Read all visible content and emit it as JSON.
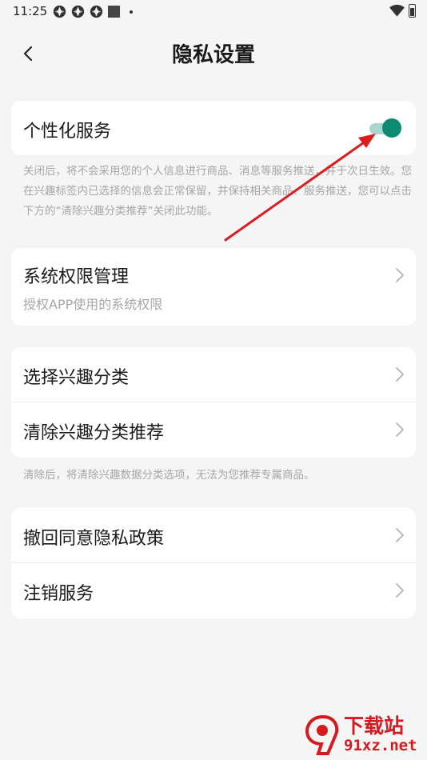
{
  "status_bar": {
    "time": "11:25",
    "icons_left": [
      "app-icon",
      "app-icon",
      "app-icon",
      "square-notification-icon",
      "dot-icon"
    ],
    "icons_right": [
      "wifi-icon",
      "battery-icon"
    ]
  },
  "header": {
    "back_icon": "chevron-left-icon",
    "title": "隐私设置"
  },
  "personalized": {
    "label": "个性化服务",
    "toggle_on": true,
    "toggle_color": "#0f8a72",
    "note": "关闭后，将不会采用您的个人信息进行商品、消息等服务推送，并于次日生效。您在兴趣标签内已选择的信息会正常保留，并保持相关商品、服务推送，您可以点击下方的“清除兴趣分类推荐”关闭此功能。"
  },
  "permissions": {
    "label": "系统权限管理",
    "subtitle": "授权APP使用的系统权限"
  },
  "interest": {
    "items": [
      {
        "label": "选择兴趣分类"
      },
      {
        "label": "清除兴趣分类推荐"
      }
    ],
    "note": "清除后，将清除兴趣数据分类选项，无法为您推荐专属商品。"
  },
  "policy": {
    "items": [
      {
        "label": "撤回同意隐私政策"
      },
      {
        "label": "注销服务"
      }
    ]
  },
  "annotation": {
    "arrow_color": "#d81e1e"
  },
  "watermark": {
    "text": "下载站",
    "url": "91xz.net",
    "color": "#d71920"
  }
}
